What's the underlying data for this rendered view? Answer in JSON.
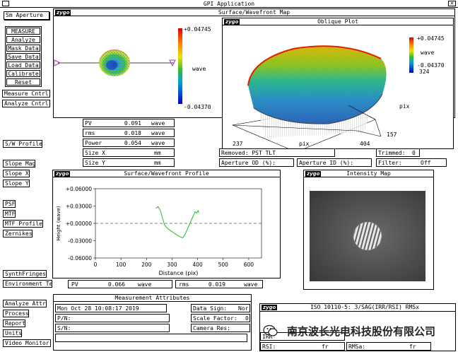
{
  "app": {
    "title": "GPI Application",
    "close_glyph": "×"
  },
  "aperture": {
    "label": "Sm Aperture"
  },
  "menu": {
    "measure": "MEASURE",
    "analyze": "Analyze",
    "mask_data": "Mask Data",
    "save_data": "Save Data",
    "load_data": "Load Data",
    "calibrate": "Calibrate",
    "reset": "Reset",
    "measure_cntrl": "Measure Cntrl",
    "analyze_cntrl": "Analyze Cntrl",
    "sw_profile": "S/W Profile",
    "slope_mag": "Slope Mag",
    "slope_x": "Slope X",
    "slope_y": "Slope Y",
    "psf": "PSF",
    "mtf": "MTF",
    "mtf_profile": "MTF Profile",
    "zernikes": "Zernikes",
    "synth_fringes": "SynthFringes",
    "environment": "Environment Te",
    "analyze_attr": "Analyze Attr",
    "process": "Process",
    "report": "Report",
    "units": "Units",
    "video_monitor": "Video Monitor"
  },
  "surface_map": {
    "title": "Surface/Wavefront Map",
    "brand": "zygo",
    "scale_max": "+0.04745",
    "scale_min": "-0.04370",
    "scale_unit": "wave"
  },
  "oblique": {
    "title": "Oblique Plot",
    "brand": "zygo",
    "scale_max": "+0.04745",
    "scale_min": "-0.04370",
    "scale_unit": "wave",
    "y_top": "324",
    "y_bottom": "157",
    "y_label": "pix",
    "x_left": "237",
    "x_right": "404",
    "x_label": "pix"
  },
  "stats": [
    {
      "label": "PV",
      "value": "0.091",
      "unit": "wave"
    },
    {
      "label": "rms",
      "value": "0.018",
      "unit": "wave"
    },
    {
      "label": "Power",
      "value": "0.054",
      "unit": "wave"
    },
    {
      "label": "Size X",
      "value": "",
      "unit": "mm"
    },
    {
      "label": "Size Y",
      "value": "",
      "unit": "mm"
    }
  ],
  "info": {
    "removed": "Removed: PST TLT",
    "trimmed_label": "Trimmed:",
    "trimmed_value": "0",
    "aperture_od": "Aperture OD (%):",
    "aperture_id": "Aperture ID (%):",
    "filter_label": "Filter:",
    "filter_value": "Off"
  },
  "profile": {
    "title": "Surface/Wavefront Profile",
    "brand": "zygo",
    "pv_label": "PV",
    "pv_value": "0.066",
    "pv_unit": "wave",
    "rms_label": "rms",
    "rms_value": "0.019",
    "rms_unit": "wave"
  },
  "intensity": {
    "title": "Intensity Map",
    "brand": "zygo"
  },
  "attributes": {
    "title": "Measurement Attributes",
    "date": "Mon Oct 28 10:08:17 2019",
    "pn_label": "P/N:",
    "sn_label": "S/N:",
    "data_sign_label": "Data Sign:",
    "data_sign_value": "Nor",
    "scale_factor_label": "Scale Factor:",
    "scale_factor_value": "0",
    "camera_res_label": "Camera Res:"
  },
  "iso": {
    "brand": "zygo",
    "title": "ISO 10110-5: 3/SAG(IRR/RSI) RMSx",
    "row_label": "IRR",
    "rsi_label": "RSI:",
    "rsi_unit": "fr",
    "rmsa_label": "RMSa:",
    "rmsa_unit": "fr"
  },
  "watermark": {
    "text": "南京波长光电科技股份有限公司"
  },
  "chart_data": {
    "type": "line",
    "title": "",
    "xlabel": "Distance (pix)",
    "ylabel": "Height (wave)",
    "xlim": [
      0,
      650
    ],
    "ylim": [
      -0.06,
      0.06
    ],
    "x_ticks": [
      0,
      100,
      200,
      300,
      400,
      500,
      600
    ],
    "y_ticks": [
      "+0.06000",
      "+0.03000",
      "+0.00000",
      "-0.03000",
      "-0.06000"
    ],
    "y_tick_values": [
      0.06,
      0.03,
      0.0,
      -0.03,
      -0.06
    ],
    "reference_line": 0.0,
    "series": [
      {
        "x": [
          237,
          245,
          255,
          262,
          270,
          280,
          292,
          305,
          318,
          330,
          342,
          350,
          358,
          366,
          374,
          382,
          390,
          396,
          402,
          404
        ],
        "y": [
          0.026,
          0.029,
          0.021,
          0.01,
          -0.002,
          -0.008,
          -0.012,
          -0.016,
          -0.02,
          -0.023,
          -0.025,
          -0.02,
          -0.012,
          -0.004,
          0.004,
          0.012,
          0.02,
          0.018,
          0.022,
          0.018
        ]
      }
    ],
    "color": "#22bb22"
  }
}
